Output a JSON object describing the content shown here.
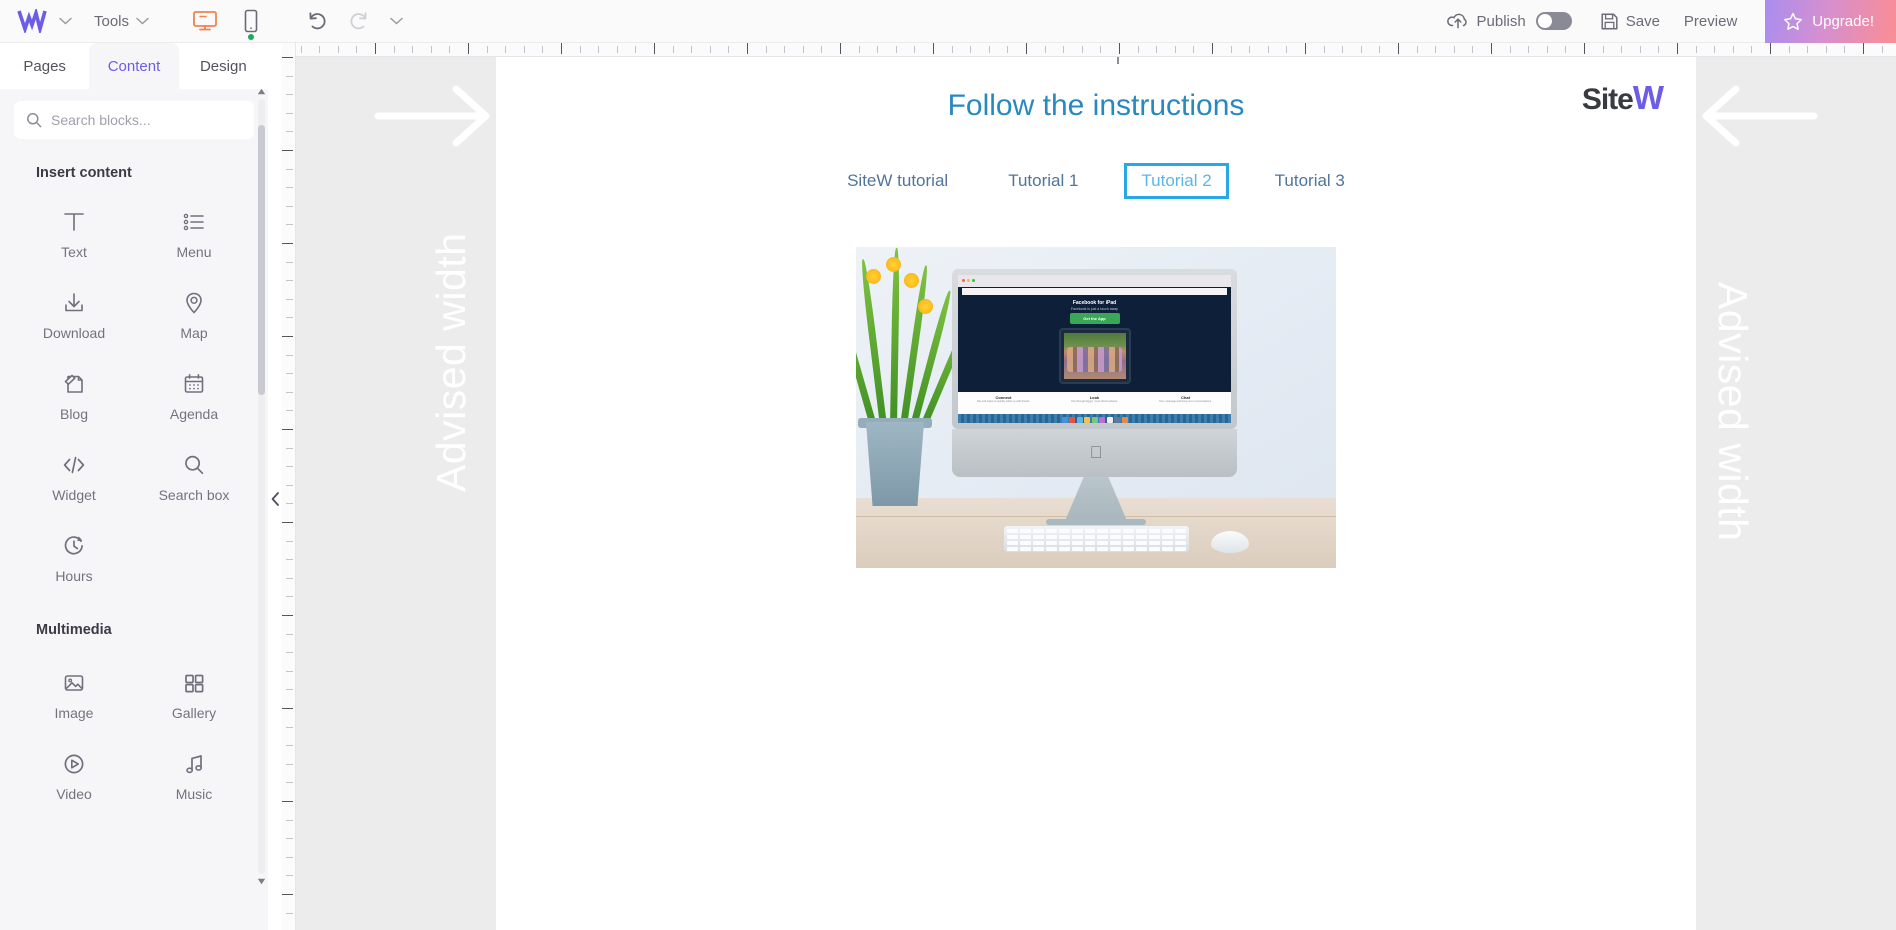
{
  "topbar": {
    "brand_icon": "sitew-w-logo",
    "brand_chevron_icon": "chevron-down-icon",
    "tools_label": "Tools",
    "tools_chevron_icon": "chevron-down-icon",
    "desktop_icon": "desktop-monitor-icon",
    "mobile_icon": "mobile-phone-icon",
    "undo_icon": "undo-arrow-icon",
    "redo_icon": "redo-arrow-icon",
    "history_chevron_icon": "chevron-down-icon",
    "publish_label": "Publish",
    "publish_icon": "publish-cloud-upload-icon",
    "publish_toggle_state": "off",
    "save_label": "Save",
    "save_icon": "floppy-disk-icon",
    "preview_label": "Preview",
    "upgrade_label": "Upgrade!",
    "upgrade_icon": "star-icon",
    "accent_orange": "#f0834f",
    "accent_purple": "#6d5ce7",
    "upgrade_gradient_from": "#a98ef0",
    "upgrade_gradient_to": "#fb8d93"
  },
  "sidebar": {
    "tabs": [
      {
        "label": "Pages",
        "active": false
      },
      {
        "label": "Content",
        "active": true
      },
      {
        "label": "Design",
        "active": false
      }
    ],
    "search": {
      "placeholder": "Search blocks...",
      "value": "",
      "icon": "search-icon"
    },
    "sections": [
      {
        "title": "Insert content",
        "items": [
          {
            "label": "Text",
            "icon": "text-t-icon"
          },
          {
            "label": "Menu",
            "icon": "menu-list-icon"
          },
          {
            "label": "Download",
            "icon": "download-icon"
          },
          {
            "label": "Map",
            "icon": "map-pin-icon"
          },
          {
            "label": "Blog",
            "icon": "blog-page-icon"
          },
          {
            "label": "Agenda",
            "icon": "calendar-icon"
          },
          {
            "label": "Widget",
            "icon": "code-widget-icon"
          },
          {
            "label": "Search box",
            "icon": "search-icon"
          },
          {
            "label": "Hours",
            "icon": "clock-hours-icon"
          }
        ]
      },
      {
        "title": "Multimedia",
        "items": [
          {
            "label": "Image",
            "icon": "image-icon"
          },
          {
            "label": "Gallery",
            "icon": "gallery-grid-icon"
          },
          {
            "label": "Video",
            "icon": "video-play-icon"
          },
          {
            "label": "Music",
            "icon": "music-note-icon"
          }
        ]
      }
    ],
    "collapse_icon": "collapse-left-arrow-icon",
    "scroll_up_icon": "triangle-up-icon",
    "scroll_down_icon": "triangle-down-icon"
  },
  "canvas": {
    "gutter_left": {
      "label": "Advised width",
      "arrow_icon": "arrow-right-icon"
    },
    "gutter_right": {
      "label": "Advised width",
      "arrow_icon": "arrow-left-icon"
    },
    "page": {
      "heading": "Follow the instructions",
      "heading_color": "#2889c0",
      "logo": {
        "text_dark": "Site",
        "text_accent": "W",
        "accent_color": "#6d5ce7"
      },
      "tutorial_links": [
        {
          "label": "SiteW tutorial",
          "selected": false
        },
        {
          "label": "Tutorial 1",
          "selected": false
        },
        {
          "label": "Tutorial 2",
          "selected": true
        },
        {
          "label": "Tutorial 3",
          "selected": false
        }
      ],
      "selection_border_color": "#29a8e8",
      "image": {
        "name": "imac-desk-photo",
        "alt": "iMac computer on a wooden desk with daffodils, keyboard and mouse",
        "screen_site": {
          "title": "Facebook for iPad",
          "subtitle": "Facebook is just a touch away",
          "button": "Get the App",
          "columns": [
            {
              "title": "Connect",
              "text": "Tap and swipe to quickly catch up with friends."
            },
            {
              "title": "Look",
              "text": "Flip through bigger, more vibrant photos."
            },
            {
              "title": "Chat",
              "text": "Text, message and hang out in conversations."
            }
          ]
        }
      }
    }
  }
}
